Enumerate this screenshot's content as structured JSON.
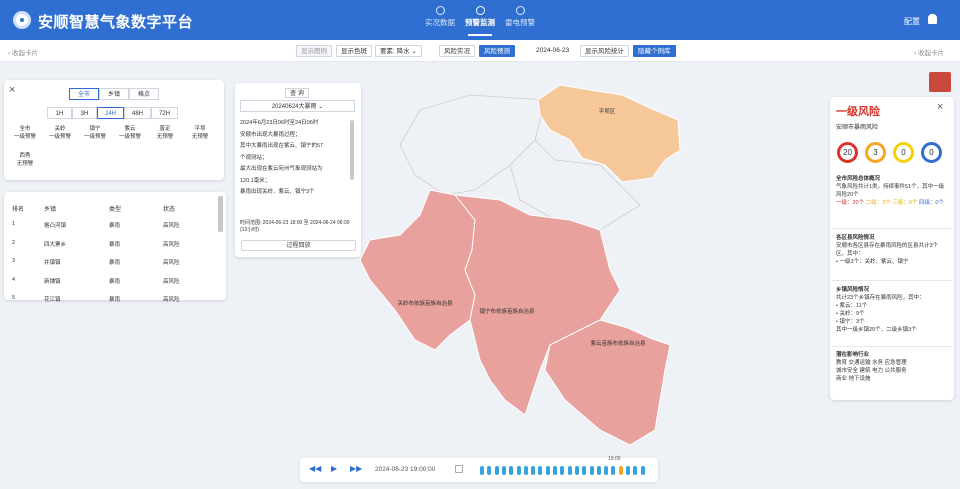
{
  "app": {
    "title": "安顺智慧气象数字平台",
    "config": "配置"
  },
  "nav": [
    "实况数据",
    "预警监测",
    "雷电预警"
  ],
  "toolbar": {
    "left_toggle": "收起卡片",
    "right_toggle": "收起卡片",
    "b1": "显示图例",
    "b2": "显示色斑",
    "b3": "要素: 降水",
    "b4": "风险实况",
    "b5": "风险预测",
    "date": "2024-06-23",
    "b6": "显示风险统计",
    "b7": "隐藏个例库"
  },
  "filter": {
    "tabs": [
      "全市",
      "乡镇",
      "格点"
    ],
    "hours": [
      "1H",
      "3H",
      "24H",
      "48H",
      "72H"
    ],
    "areas": [
      [
        "全市",
        "一级预警"
      ],
      [
        "关岭",
        "一级预警"
      ],
      [
        "镇宁",
        "一级预警"
      ],
      [
        "紫云",
        "一级预警"
      ],
      [
        "普定",
        "无预警"
      ],
      [
        "平坝",
        "无预警"
      ],
      [
        "西秀",
        "无预警"
      ]
    ]
  },
  "table": {
    "headers": [
      "排名",
      "乡镇",
      "类型",
      "状态"
    ],
    "rows": [
      [
        "1",
        "格凸河镇",
        "暴雨",
        "高风险"
      ],
      [
        "2",
        "四大寨乡",
        "暴雨",
        "高风险"
      ],
      [
        "3",
        "并镇镇",
        "暴雨",
        "高风险"
      ],
      [
        "4",
        "新铺镇",
        "暴雨",
        "高风险"
      ],
      [
        "5",
        "花江镇",
        "暴雨",
        "高风险"
      ]
    ]
  },
  "case": {
    "query": "查 询",
    "select": "20240624大暴雨",
    "lines": [
      "2024年6月23日06时至24日06时",
      "安顺市出现大暴雨过程；",
      "其中大暴雨出现在紫云、镇宁的57",
      "个观测站；",
      "最大出现在紫云宛州气象观测站为",
      "120.1毫米；",
      "暴雨出现关岭、紫云、镇宁3个"
    ],
    "range": "时间范围: 2024-06-23 18:00 至 2024-06-24 06:00 (12小时)",
    "replay": "过程回放"
  },
  "map": {
    "labels": [
      "平坝区",
      "关岭布依族苗族自治县",
      "镇宁布依族苗族自治县",
      "紫云苗族布依族自治县"
    ],
    "colors": {
      "high": "#e8a19c",
      "mid": "#f5c799",
      "none": "#ffffff"
    }
  },
  "warn": {
    "title": "一级风险",
    "subtitle": "安顺市暴雨风险",
    "counts": [
      "20",
      "3",
      "0",
      "0"
    ],
    "ring_colors": [
      "#d9342b",
      "#f5a623",
      "#f2d100",
      "#2f6fd1"
    ],
    "s1_title": "全市风险总体概况",
    "s1_text": "气象风险共计1类，持续事件51个，其中一级风险20个",
    "s1_levels": [
      "一级：20个",
      "二级：3个",
      "三级：0个",
      "四级：0个"
    ],
    "s2_title": "各区县风险情况",
    "s2_text": "安顺市各区县存在暴雨风险的区县共计3个区，其中：",
    "s2_item": "一级3个：关岭、紫云、镇宁",
    "s3_title": "乡镇风险情况",
    "s3_text": "共计23个乡镇存在暴雨风险，其中：",
    "s3_items": [
      "紫云：11个",
      "关岭：9个",
      "镇宁：3个"
    ],
    "s3_foot": "其中一级乡镇20个，二级乡镇3个",
    "s4_title": "潜在影响行业",
    "s4_items": [
      "教育",
      "交通运输",
      "水务",
      "应急管理",
      "城市安全",
      "建筑",
      "电力",
      "公共服务",
      "商业",
      "地下设施"
    ]
  },
  "timeline": {
    "time": "2024-06-23 19:00:00",
    "marker": "19:00",
    "dots": 23,
    "current": 19
  }
}
